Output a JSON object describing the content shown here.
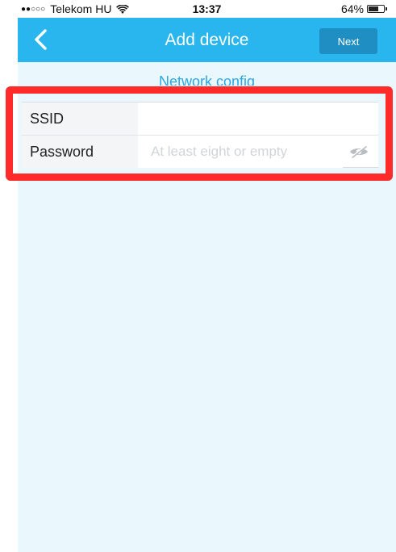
{
  "status_bar": {
    "signal": "●●○○○",
    "carrier": "Telekom HU",
    "time": "13:37",
    "battery_percent": "64%",
    "battery_level": 0.64,
    "icons": [
      "wifi-icon",
      "battery-icon"
    ]
  },
  "nav": {
    "title": "Add device",
    "back_icon": "chevron-left-icon",
    "next_label": "Next"
  },
  "section": {
    "title": "Network config"
  },
  "form": {
    "ssid": {
      "label": "SSID",
      "value": "",
      "placeholder": ""
    },
    "password": {
      "label": "Password",
      "value": "",
      "placeholder": "At least eight or empty",
      "toggle_icon": "eye-off-icon"
    }
  },
  "colors": {
    "nav_background": "#29b6ee",
    "next_button": "#1f8fc3",
    "page_background": "#eaf7fd",
    "section_title": "#29a8e4",
    "highlight": "#ff2a2a"
  }
}
